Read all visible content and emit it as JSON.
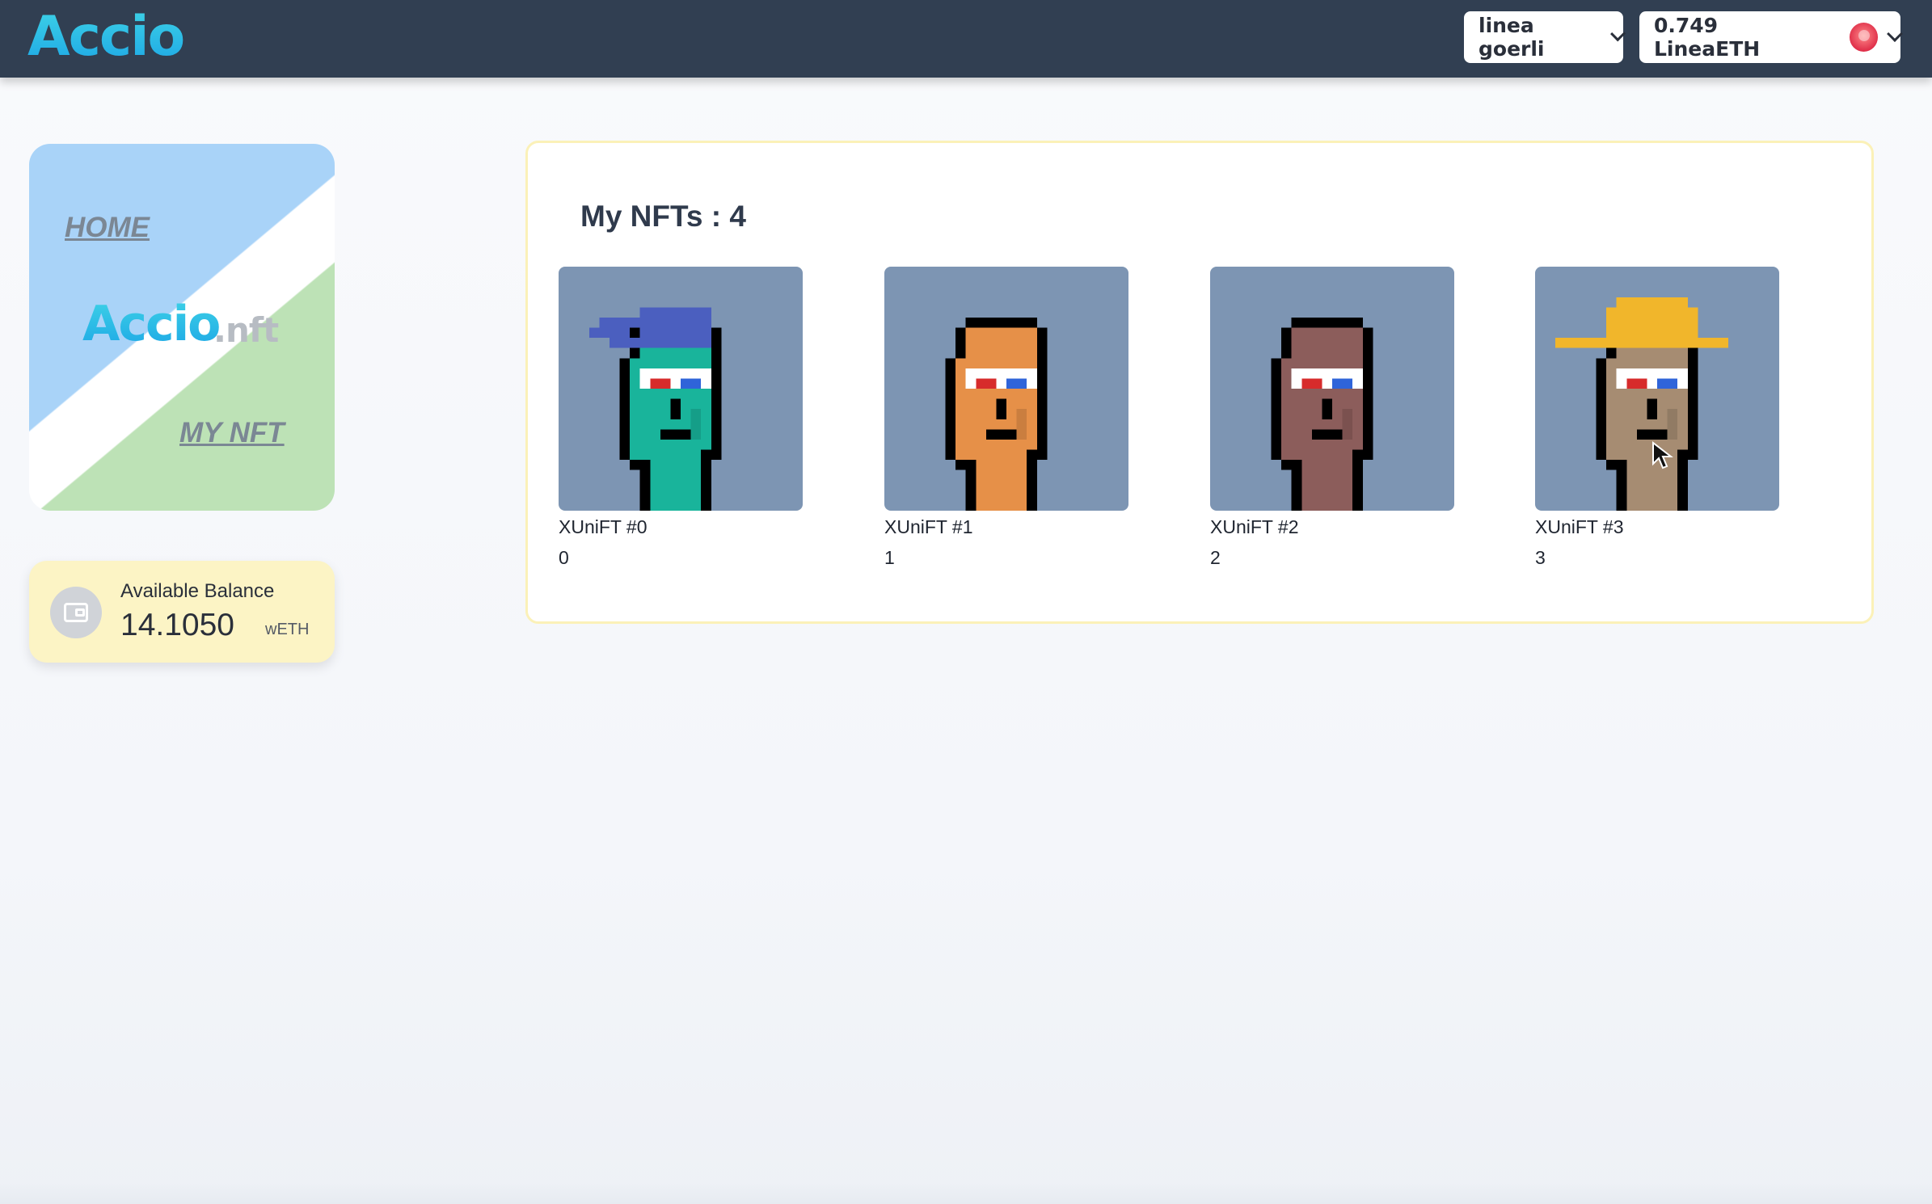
{
  "header": {
    "logo": "Accio",
    "network": "linea goerli",
    "account_balance": "0.749 LineaETH",
    "account_avatar_icon": "account-avatar-icon"
  },
  "sidebar": {
    "home_label": "HOME",
    "brand": "Accio",
    "brand_suffix": ".nft",
    "mynft_label": "MY NFT"
  },
  "balance": {
    "label": "Available Balance",
    "value": "14.1050",
    "unit": "wETH",
    "icon": "wallet-icon"
  },
  "nft_panel": {
    "title": "My NFTs : 4",
    "items": [
      {
        "name": "XUniFT #0",
        "id": "0",
        "skin": "#19b49b",
        "hair": "#4b5fbf",
        "hat": "bandana"
      },
      {
        "name": "XUniFT #1",
        "id": "1",
        "skin": "#e69048",
        "hair": "#000000",
        "hat": "none"
      },
      {
        "name": "XUniFT #2",
        "id": "2",
        "skin": "#8c5d5b",
        "hair": "#000000",
        "hat": "none"
      },
      {
        "name": "XUniFT #3",
        "id": "3",
        "skin": "#a68c72",
        "hair": "#f1b62b",
        "hat": "hardhat"
      }
    ]
  },
  "colors": {
    "topbar": "#313f52",
    "nft_bg": "#7d95b3",
    "balance_card": "#fcf4c5",
    "panel_border": "#fbf1b8"
  }
}
